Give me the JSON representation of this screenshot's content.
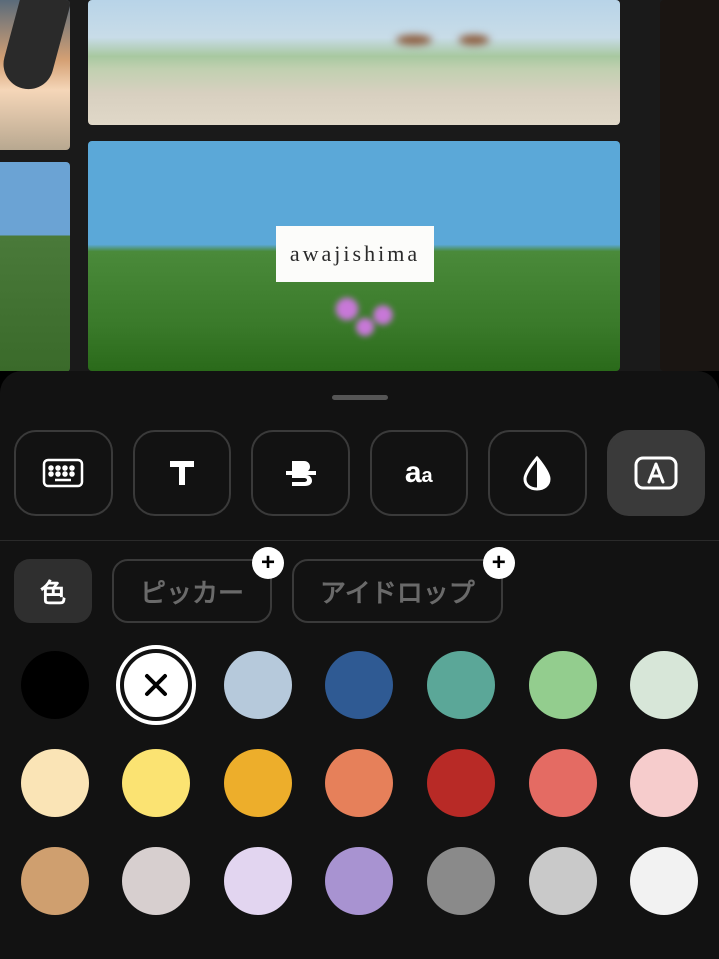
{
  "overlay": {
    "text": "awajishima"
  },
  "tools": [
    {
      "name": "keyboard",
      "active": false
    },
    {
      "name": "font",
      "active": false
    },
    {
      "name": "strikethrough",
      "active": false
    },
    {
      "name": "text-size",
      "active": false
    },
    {
      "name": "color-drop",
      "active": false
    },
    {
      "name": "background",
      "active": true
    }
  ],
  "tabs": {
    "color": {
      "label": "色",
      "active": true,
      "plus": false
    },
    "picker": {
      "label": "ピッカー",
      "active": false,
      "plus": true
    },
    "eyedrop": {
      "label": "アイドロップ",
      "active": false,
      "plus": true
    }
  },
  "swatches": {
    "rows": [
      [
        "#000000",
        "selected-white",
        "#b6c9db",
        "#2f5a93",
        "#5ba798",
        "#93cd8e",
        "#d7e6d8"
      ],
      [
        "#fae4b6",
        "#fbe372",
        "#edae2b",
        "#e6805a",
        "#b82a26",
        "#e46b63",
        "#f6cccc"
      ],
      [
        "#cf9f6f",
        "#d7cfcf",
        "#e2d5f0",
        "#a893d1",
        "#8a8a8a",
        "#c9c9c9",
        "#f2f2f2"
      ]
    ]
  },
  "plus_glyph": "+",
  "x_glyph": "✕"
}
